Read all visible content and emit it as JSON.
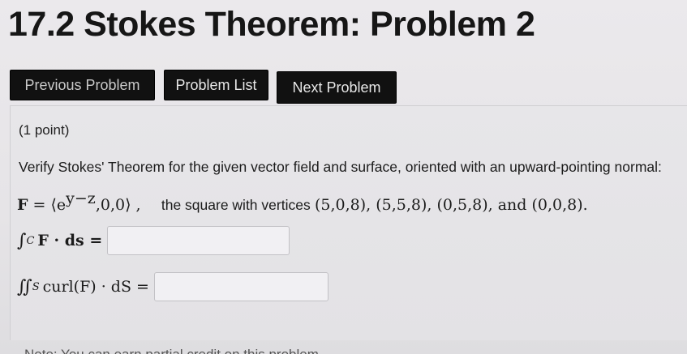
{
  "header": {
    "title": "17.2 Stokes Theorem: Problem 2"
  },
  "nav": {
    "previous_label": "Previous Problem",
    "list_label": "Problem List",
    "next_label": "Next Problem"
  },
  "problem": {
    "points": "(1 point)",
    "statement": "Verify Stokes' Theorem for the given vector field and surface, oriented with an upward-pointing normal:",
    "field_lhs": "F",
    "field_eq": " = ⟨e",
    "field_exp": "y−z",
    "field_rest": ",0,0⟩ ,",
    "surface_desc": "the square with vertices",
    "vertices": "(5,0,8), (5,5,8), (0,5,8), and (0,0,8).",
    "line_integral_prefix": "∫",
    "line_integral_sub": "C",
    "line_integral_body": "F · ds =",
    "surface_integral_prefix": "∬",
    "surface_integral_sub": "S",
    "surface_integral_body": "curl(F) · dS =",
    "answer1_value": "",
    "answer2_value": ""
  },
  "footer": {
    "note": "Note: You can earn partial credit on this problem."
  },
  "colors": {
    "button_bg": "#111111",
    "page_bg": "#e8e6e9"
  }
}
